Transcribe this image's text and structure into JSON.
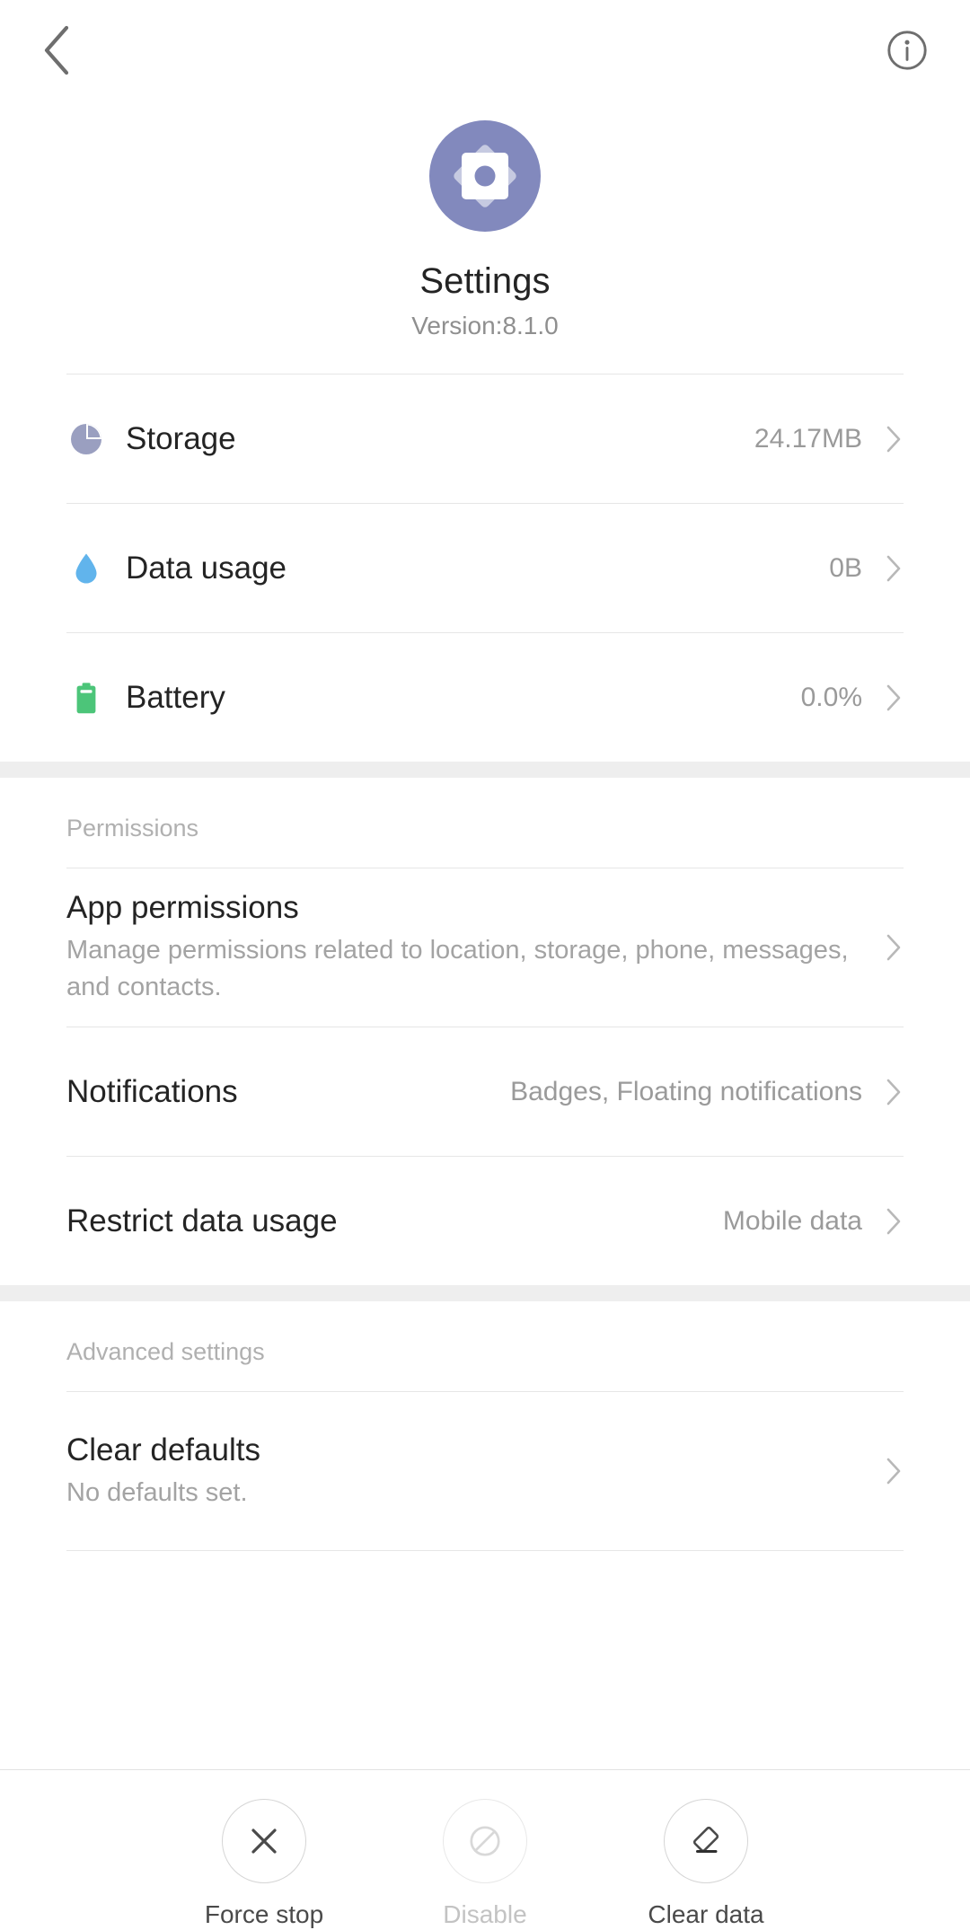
{
  "topbar": {
    "back_icon": "chevron-left-icon",
    "info_icon": "info-circle-icon"
  },
  "app": {
    "icon": "settings-gear-icon",
    "icon_bg_color": "#8289bd",
    "icon_fg_color": "#ffffff",
    "name": "Settings",
    "version": "Version:8.1.0"
  },
  "usage_section": {
    "rows": [
      {
        "icon": "pie-chart-icon",
        "icon_color": "#9a9fc0",
        "title": "Storage",
        "value": "24.17MB"
      },
      {
        "icon": "water-drop-icon",
        "icon_color": "#61b4ec",
        "title": "Data usage",
        "value": "0B"
      },
      {
        "icon": "battery-icon",
        "icon_color": "#4cc579",
        "title": "Battery",
        "value": "0.0%"
      }
    ]
  },
  "permissions_section": {
    "label": "Permissions",
    "rows": [
      {
        "title": "App permissions",
        "subtitle": "Manage permissions related to location, storage, phone, messages, and contacts.",
        "value": ""
      },
      {
        "title": "Notifications",
        "subtitle": "",
        "value": "Badges, Floating notifications"
      },
      {
        "title": "Restrict data usage",
        "subtitle": "",
        "value": "Mobile data"
      }
    ]
  },
  "advanced_section": {
    "label": "Advanced settings",
    "rows": [
      {
        "title": "Clear defaults",
        "subtitle": "No defaults set.",
        "value": ""
      }
    ]
  },
  "actionbar": {
    "actions": [
      {
        "icon": "close-x-icon",
        "label": "Force stop",
        "disabled": false
      },
      {
        "icon": "block-icon",
        "label": "Disable",
        "disabled": true
      },
      {
        "icon": "eraser-icon",
        "label": "Clear data",
        "disabled": false
      }
    ]
  },
  "colors": {
    "divider": "#e6e6e6",
    "band": "#eeeeee",
    "title_text": "#242424",
    "secondary_text": "#a3a3a3",
    "value_text": "#9a9a9a"
  }
}
